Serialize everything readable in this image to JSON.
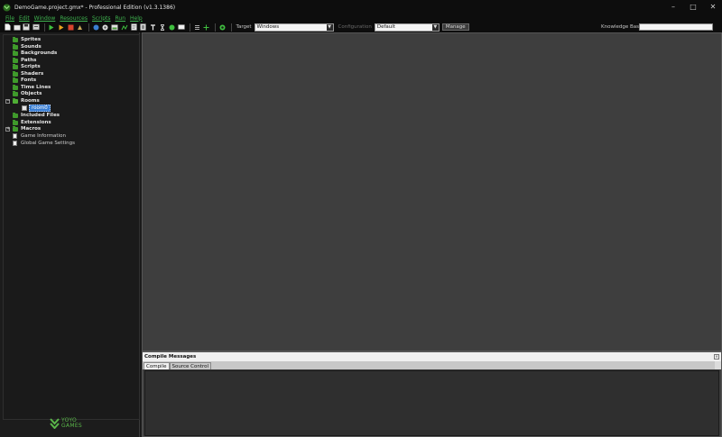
{
  "window": {
    "title": "DemoGame.project.gmx* - Professional Edition (v1.3.1386)",
    "minimize": "–",
    "maximize": "□",
    "close": "✕"
  },
  "menu": [
    "File",
    "Edit",
    "Window",
    "Resources",
    "Scripts",
    "Run",
    "Help"
  ],
  "toolbar": {
    "target_label": "Target",
    "target_value": "Windows",
    "configuration_label": "Configuration",
    "configuration_value": "Default",
    "manage_label": "Manage",
    "knowledge_base_label": "Knowledge Base:",
    "knowledge_base_value": "",
    "icons": [
      "new-icon",
      "open-icon",
      "save-icon",
      "export-icon",
      "run-icon",
      "debug-icon",
      "stop-icon",
      "clean-icon",
      "create-sprite-icon",
      "create-sound-icon",
      "create-background-icon",
      "create-path-icon",
      "create-script-icon",
      "create-shader-icon",
      "create-font-icon",
      "create-timeline-icon",
      "create-object-icon",
      "create-room-icon",
      "game-info-icon",
      "global-settings-icon",
      "extensions-icon",
      "help-icon"
    ]
  },
  "tree": {
    "items": [
      {
        "label": "Sprites",
        "type": "folder"
      },
      {
        "label": "Sounds",
        "type": "folder"
      },
      {
        "label": "Backgrounds",
        "type": "folder"
      },
      {
        "label": "Paths",
        "type": "folder"
      },
      {
        "label": "Scripts",
        "type": "folder"
      },
      {
        "label": "Shaders",
        "type": "folder"
      },
      {
        "label": "Fonts",
        "type": "folder"
      },
      {
        "label": "Time Lines",
        "type": "folder"
      },
      {
        "label": "Objects",
        "type": "folder"
      },
      {
        "label": "Rooms",
        "type": "folder-open"
      },
      {
        "label": "room0",
        "type": "room"
      },
      {
        "label": "Included Files",
        "type": "folder"
      },
      {
        "label": "Extensions",
        "type": "folder"
      },
      {
        "label": "Macros",
        "type": "folder"
      },
      {
        "label": "Game Information",
        "type": "doc"
      },
      {
        "label": "Global Game Settings",
        "type": "doc"
      }
    ]
  },
  "logo": {
    "line1": "YOYO",
    "line2": "GAMES"
  },
  "compile": {
    "title": "Compile Messages",
    "tabs": [
      "Compile",
      "Source Control"
    ],
    "active_tab": "Compile"
  },
  "colors": {
    "accent_green": "#3fb34f",
    "folder_green": "#3f9a2b",
    "selection_blue": "#3a7ed2",
    "workspace": "#3e3e3e"
  }
}
